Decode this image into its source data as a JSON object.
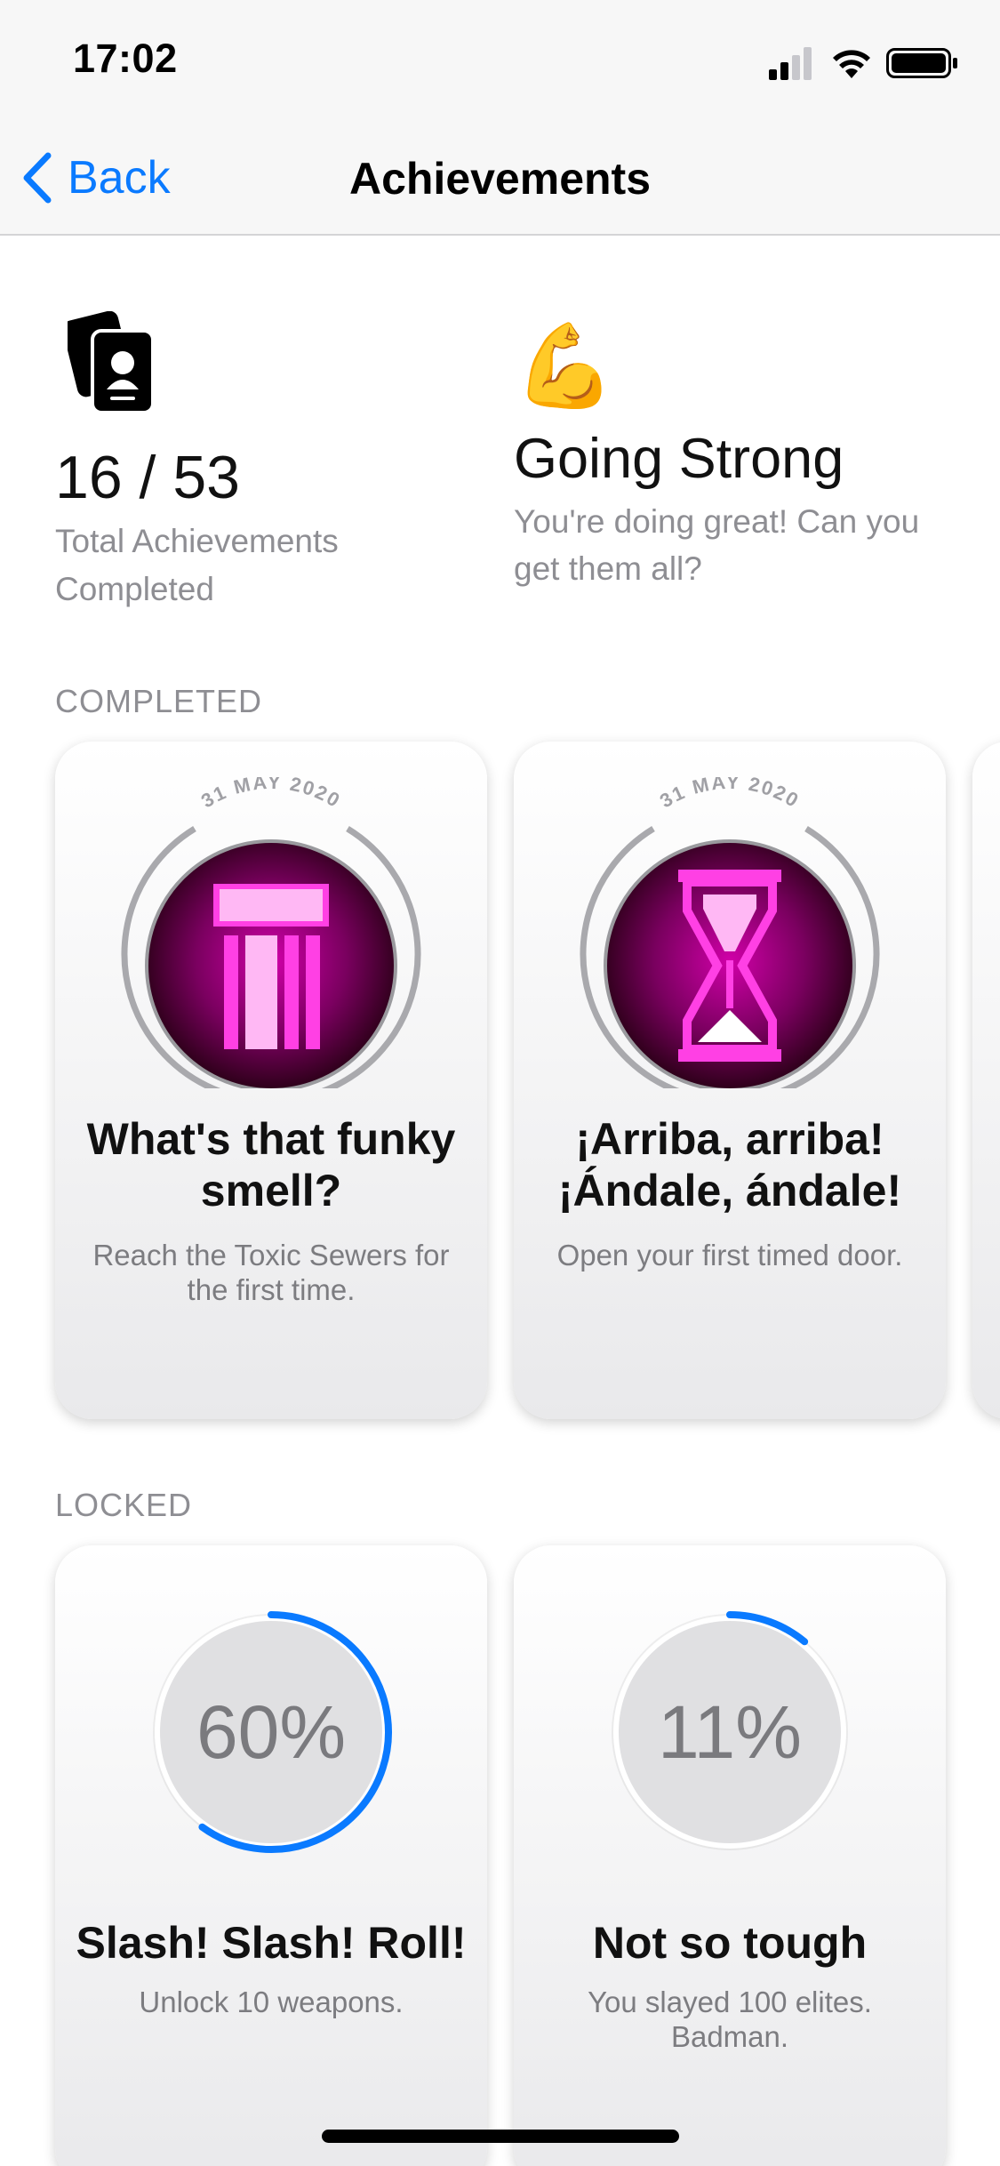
{
  "status_bar": {
    "time": "17:02"
  },
  "nav": {
    "back_label": "Back",
    "title": "Achievements"
  },
  "summary": {
    "count": "16 / 53",
    "count_label": "Total Achievements Completed",
    "rank_emoji": "💪",
    "rank_title": "Going Strong",
    "rank_desc": "You're doing great! Can you get them all?"
  },
  "sections": {
    "completed": "COMPLETED",
    "locked": "LOCKED"
  },
  "completed": [
    {
      "date": "31 MAY 2020",
      "icon": "pipe-icon",
      "title": "What's that funky smell?",
      "desc": "Reach the Toxic Sewers for the first time."
    },
    {
      "date": "31 MAY 2020",
      "icon": "hourglass-icon",
      "title": "¡Arriba, arriba! ¡Ándale, ándale!",
      "desc": "Open your first timed door."
    }
  ],
  "locked": [
    {
      "percent_label": "60%",
      "progress": 0.6,
      "title": "Slash! Slash! Roll!",
      "desc": "Unlock 10 weapons."
    },
    {
      "percent_label": "11%",
      "progress": 0.11,
      "title": "Not so tough",
      "desc": "You slayed 100 elites. Badman."
    }
  ],
  "colors": {
    "accent": "#0a7aff",
    "badge": "#e600c8",
    "badge_dark": "#2a0018"
  }
}
